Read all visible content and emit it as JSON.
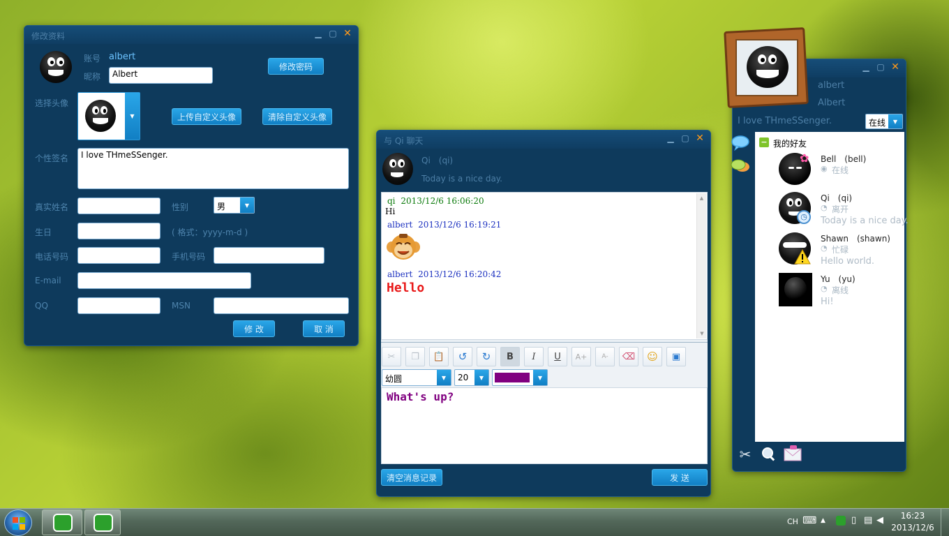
{
  "profile_window": {
    "title": "修改资料",
    "account_label": "账号",
    "account_value": "albert",
    "nickname_label": "昵称",
    "nickname_value": "Albert",
    "change_password_button": "修改密码",
    "choose_avatar_label": "选择头像",
    "upload_avatar_button": "上传自定义头像",
    "clear_avatar_button": "清除自定义头像",
    "signature_label": "个性签名",
    "signature_value": "I love THmeSSenger.",
    "realname_label": "真实姓名",
    "gender_label": "性别",
    "gender_value": "男",
    "birthday_label": "生日",
    "birthday_hint": "( 格式：yyyy-m-d )",
    "phone_label": "电话号码",
    "mobile_label": "手机号码",
    "email_label": "E-mail",
    "qq_label": "QQ",
    "msn_label": "MSN",
    "modify_button": "修 改",
    "cancel_button": "取 消"
  },
  "chat_window": {
    "title": "与 Qi 聊天",
    "contact_name": "Qi　(qi)",
    "contact_signature": "Today is a nice day.",
    "messages": [
      {
        "sender": "qi",
        "time": "2013/12/6 16:06:20",
        "text": "Hi",
        "sender_color": "#0a7a0a"
      },
      {
        "sender": "albert",
        "time": "2013/12/6 16:19:21",
        "text": "",
        "sender_color": "#1a2fbf"
      },
      {
        "sender": "albert",
        "time": "2013/12/6 16:20:42",
        "text": "Hello",
        "sender_color": "#1a2fbf"
      }
    ],
    "font_name": "幼圆",
    "font_size": "20",
    "font_color": "#800080",
    "input_text": "What's up?",
    "clear_history_button": "清空消息记录",
    "send_button": "发 送",
    "toolbar": {
      "bold": "B",
      "italic": "I",
      "underline": "U",
      "grow": "A+",
      "shrink": "A-"
    }
  },
  "main_window": {
    "username": "albert",
    "nickname": "Albert",
    "signature": "I love THmeSSenger.",
    "status_value": "在线",
    "group_name": "我的好友",
    "friends": [
      {
        "name": "Bell　(bell)",
        "status": "在线",
        "signature": ""
      },
      {
        "name": "Qi　(qi)",
        "status": "离开",
        "signature": "Today is a nice day."
      },
      {
        "name": "Shawn　(shawn)",
        "status": "忙碌",
        "signature": "Hello world."
      },
      {
        "name": "Yu　(yu)",
        "status": "离线",
        "signature": "Hi!"
      }
    ]
  },
  "taskbar": {
    "lang": "CH",
    "time": "16:23",
    "date": "2013/12/6"
  }
}
